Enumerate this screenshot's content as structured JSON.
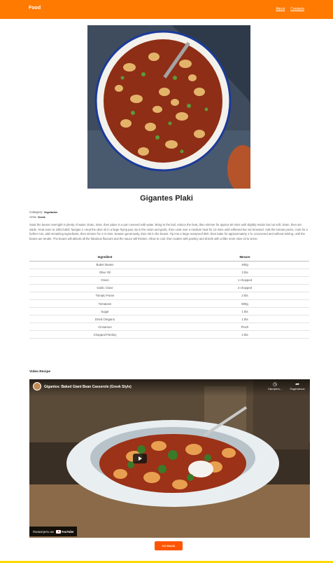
{
  "nav": {
    "brand": "Food",
    "links": [
      "About",
      "Contacts"
    ]
  },
  "recipe": {
    "title": "Gigantes Plaki",
    "category_label": "Category:",
    "category_value": "Vegetarian",
    "area_label": "Area:",
    "area_value": "Greek",
    "instructions": "Soak the beans overnight in plenty of water. Drain, rinse, then place in a pan covered with water. Bring to the boil, reduce the heat, then simmer for approx 50 mins until slightly tender but not soft. Drain, then set aside. Heat oven to 180C/160C fan/gas 4. Heat the olive oil in a large frying pan, tip in the onion and garlic, then cook over a medium heat for 10 mins until softened but not browned. Add the tomato purée, cook for a further min, add remaining ingredients, then simmer for 2-3 mins. Season generously, then stir in the beans. Tip into a large ovenproof dish, then bake for approximately 1 hr, uncovered and without stirring, until the beans are tender. The beans will absorb all the fabulous flavours and the sauce will thicken. Allow to cool, then scatter with parsley and drizzle with a little more olive oil to serve."
  },
  "table": {
    "headers": [
      "Ingredient",
      "Mesure"
    ],
    "rows": [
      [
        "Butter Beans",
        "400g"
      ],
      [
        "Olive Oil",
        "3 tbs"
      ],
      [
        "Onion",
        "1 chopped"
      ],
      [
        "Garlic Clove",
        "2 chopped"
      ],
      [
        "Tomato Puree",
        "2 tbs"
      ],
      [
        "Tomatoes",
        "800g"
      ],
      [
        "Sugar",
        "1 tbs"
      ],
      [
        "Dried Oregano",
        "1 tbs"
      ],
      [
        "Cinnamon",
        "Pinch"
      ],
      [
        "Chopped Parsley",
        "2 tbs"
      ]
    ]
  },
  "video": {
    "section_label": "Video Recipe",
    "title": "Gigantes: Baked Giant Bean Casserole (Greek Style)",
    "watch_later": "Смотреть...",
    "share": "Поделиться",
    "watch_on": "Посмотреть на",
    "youtube": "YouTube"
  },
  "back_button": "GO BACK",
  "colors": {
    "header": "#ff7a00",
    "button": "#ff5500",
    "footer_stripe": "#ffd800"
  }
}
